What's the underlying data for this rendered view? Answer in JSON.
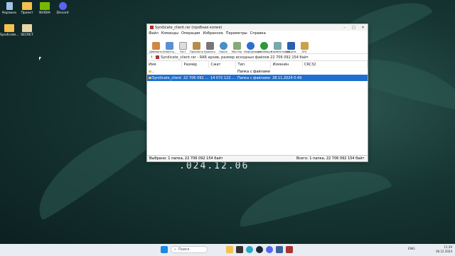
{
  "desktop": {
    "icons": [
      {
        "label": "Корзина"
      },
      {
        "label": "Проект"
      },
      {
        "label": "NVIDIA"
      },
      {
        "label": "Discord"
      },
      {
        "label": "Syndicate..."
      },
      {
        "label": "SECRET"
      }
    ],
    "clock_overlay": ".024.12.06"
  },
  "window": {
    "title": "Syndicate_client.rar (пробная копия)",
    "menu": [
      "Файл",
      "Команды",
      "Операции",
      "Избранное",
      "Параметры",
      "Справка"
    ],
    "toolbar": [
      "Добавить",
      "Извлечь...",
      "Тест",
      "Просмотр",
      "Удалить",
      "Поиск",
      "Мастер",
      "Информация",
      "Антивирус",
      "Комментарий",
      "Защита",
      "SFX"
    ],
    "address": "Syndicate_client.rar - RAR архив, размер исходных файлов 22 706 092 154 байт",
    "columns": [
      "Имя",
      "Размер",
      "Сжат",
      "Тип",
      "Изменён",
      "CRC32"
    ],
    "rows": [
      {
        "name": "..",
        "size": "",
        "packed": "",
        "type": "Папка с файлами",
        "modified": "",
        "crc": ""
      },
      {
        "name": "Syndicate_client",
        "size": "22 706 092 ...",
        "packed": "14 072 122 ...",
        "type": "Папка с файлами",
        "modified": "28.11.2024 0:49",
        "crc": ""
      }
    ],
    "status_left": "Выбрано: 1 папка, 22 706 092 154 байт",
    "status_right": "Всего: 1 папка, 22 706 092 154 байт"
  },
  "taskbar": {
    "search_placeholder": "Поиск",
    "lang": "ENG",
    "time": "11:39",
    "date": "06.12.2024"
  },
  "colors": {
    "selection": "#1f6fd0",
    "taskbar": "#e7edf0"
  }
}
